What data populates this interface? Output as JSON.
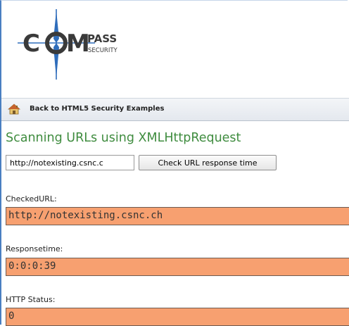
{
  "logo": {
    "text_main": "COMPASS",
    "text_sub": "SECURITY"
  },
  "nav": {
    "back_label": "Back to HTML5 Security Examples",
    "icon": "home-icon"
  },
  "page": {
    "title": "Scanning URLs using XMLHttpRequest"
  },
  "form": {
    "url_value": "http://notexisting.csnc.c",
    "check_button_label": "Check URL response time"
  },
  "results": {
    "checked_url_label": "CheckedURL:",
    "checked_url_value": "http://notexisting.csnc.ch",
    "responsetime_label": "Responsetime:",
    "responsetime_value": "0:0:0:39",
    "http_status_label": "HTTP Status:",
    "http_status_value": "0"
  },
  "colors": {
    "title_green": "#3f8c3f",
    "output_orange": "#f7a070",
    "frame_blue": "#4a7fc1"
  }
}
